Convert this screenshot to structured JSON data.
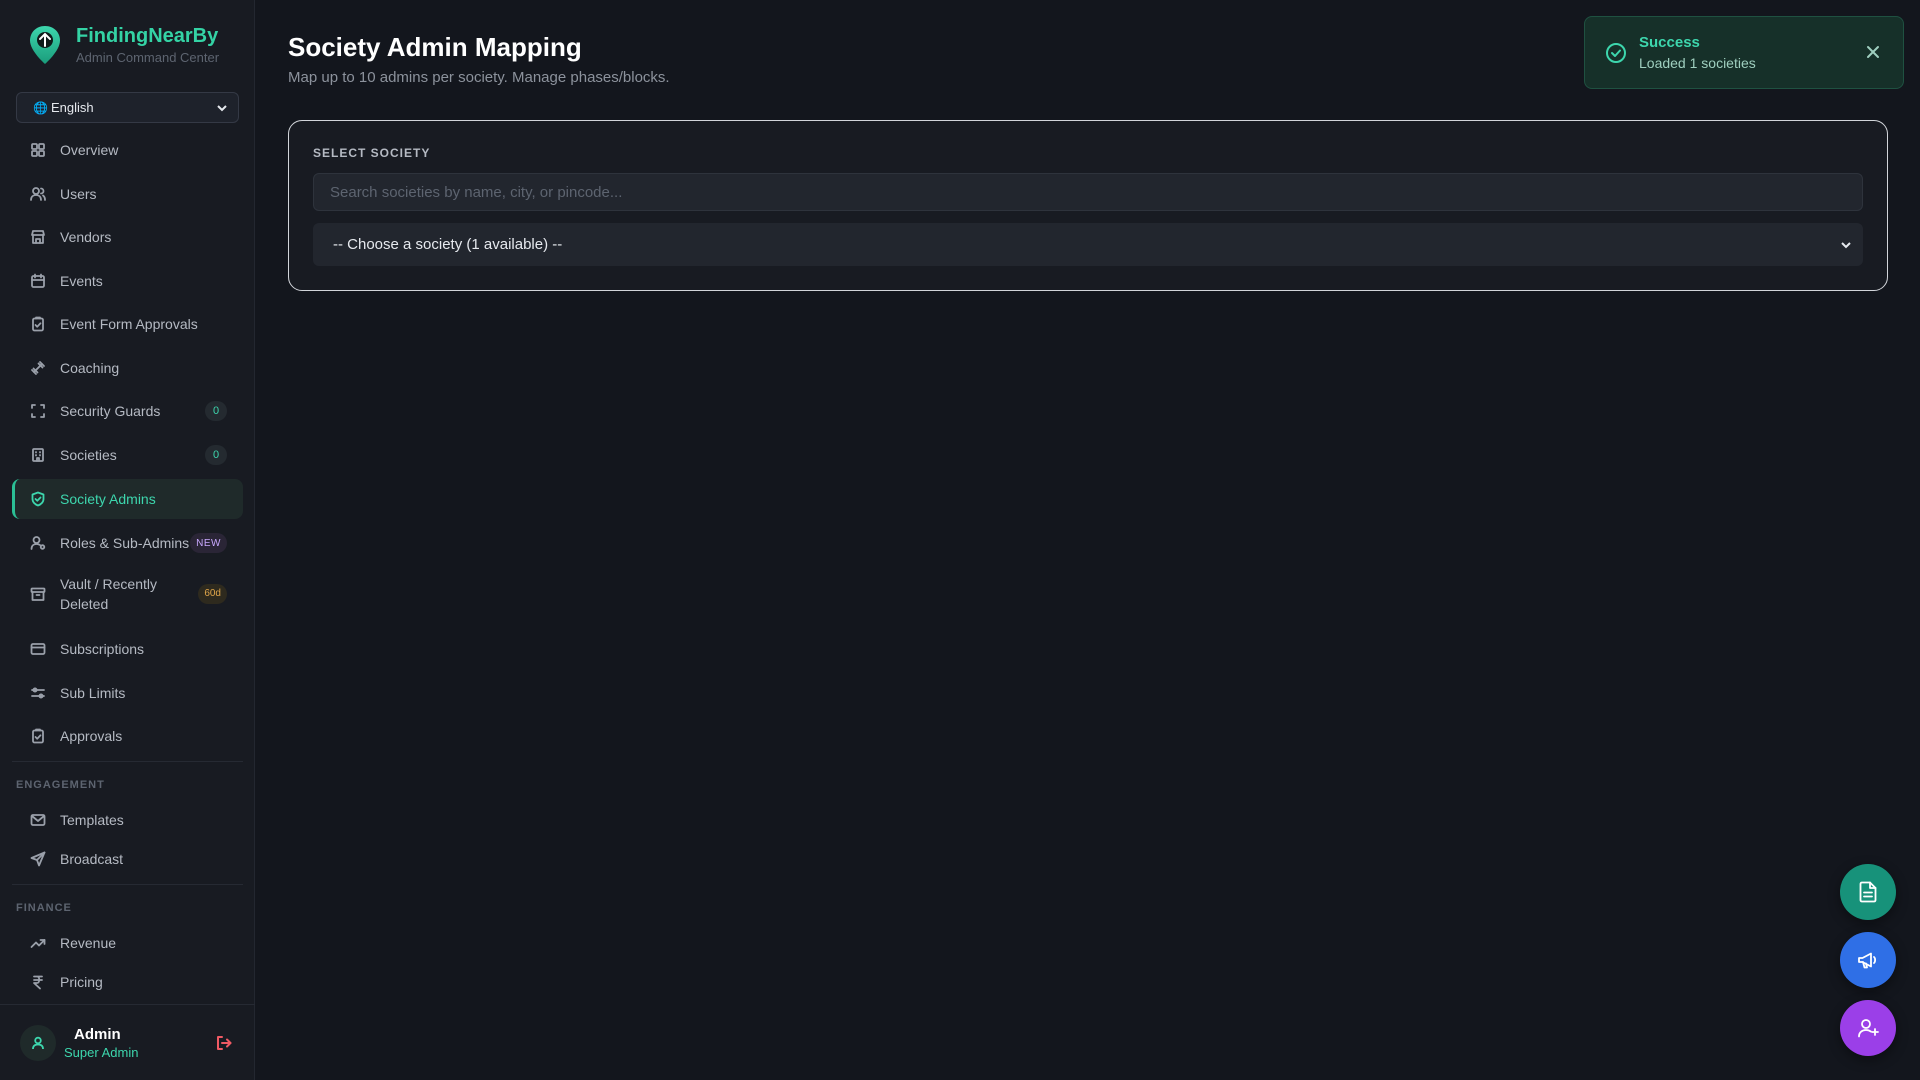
{
  "brand": {
    "title": "FindingNearBy",
    "subtitle": "Admin Command Center"
  },
  "language": {
    "globe": "🌐",
    "selected": "English"
  },
  "sidebar": {
    "items": [
      {
        "label": "Overview",
        "icon": "grid-icon"
      },
      {
        "label": "Users",
        "icon": "users-icon"
      },
      {
        "label": "Vendors",
        "icon": "store-icon"
      },
      {
        "label": "Events",
        "icon": "calendar-icon"
      },
      {
        "label": "Event Form Approvals",
        "icon": "clipboard-check-icon"
      },
      {
        "label": "Coaching",
        "icon": "dumbbell-icon"
      },
      {
        "label": "Security Guards",
        "icon": "scan-icon",
        "badge": "0"
      },
      {
        "label": "Societies",
        "icon": "building-icon",
        "badge": "0"
      },
      {
        "label": "Society Admins",
        "icon": "shield-check-icon",
        "active": true
      },
      {
        "label": "Roles & Sub-Admins",
        "icon": "user-cog-icon",
        "badge": "NEW"
      },
      {
        "label": "Vault / Recently Deleted",
        "icon": "archive-icon",
        "badge": "60d"
      },
      {
        "label": "Subscriptions",
        "icon": "credit-card-icon"
      },
      {
        "label": "Sub Limits",
        "icon": "sliders-icon"
      },
      {
        "label": "Approvals",
        "icon": "clipboard-check-icon"
      }
    ],
    "engagement_label": "ENGAGEMENT",
    "engagement": [
      {
        "label": "Templates",
        "icon": "mail-icon"
      },
      {
        "label": "Broadcast",
        "icon": "send-icon"
      }
    ],
    "finance_label": "FINANCE",
    "finance": [
      {
        "label": "Revenue",
        "icon": "trending-up-icon"
      },
      {
        "label": "Pricing",
        "icon": "rupee-icon"
      }
    ]
  },
  "user": {
    "name": "Admin",
    "role": "Super Admin"
  },
  "main": {
    "title": "Society Admin Mapping",
    "subtitle": "Map up to 10 admins per society. Manage phases/blocks.",
    "card": {
      "label": "SELECT SOCIETY",
      "search_placeholder": "Search societies by name, city, or pincode...",
      "search_value": "",
      "select_value": "-- Choose a society (1 available) --"
    }
  },
  "toast": {
    "title": "Success",
    "message": "Loaded 1 societies"
  },
  "colors": {
    "accent": "#3dd6ad",
    "fab_docs": "#17927a",
    "fab_broadcast": "#2f6fe6",
    "fab_add_user": "#9b3fe8",
    "logout": "#f05a64"
  }
}
